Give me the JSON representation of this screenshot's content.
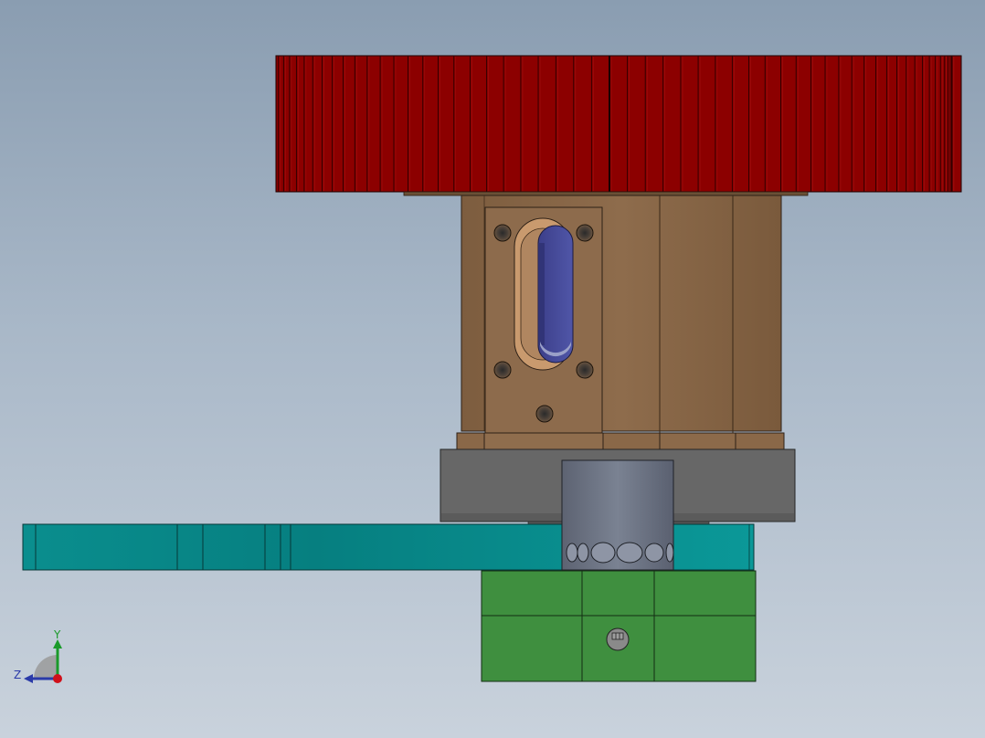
{
  "viewport": {
    "view_name": "Right",
    "background_top": "#8a9db1",
    "background_bottom": "#c9d2dc"
  },
  "parts": {
    "gear": {
      "name": "gear",
      "color": "#8c0000"
    },
    "motor_housing": {
      "name": "motor-housing",
      "color": "#8b6848"
    },
    "motor_window_slot": {
      "name": "motor-window-slot",
      "color": "#4a4fa0"
    },
    "grey_collar": {
      "name": "grey-collar",
      "color": "#676767"
    },
    "shaft": {
      "name": "shaft",
      "color": "#6e7585"
    },
    "teal_arm": {
      "name": "teal-arm",
      "color": "#0b9494"
    },
    "green_block": {
      "name": "green-block",
      "color": "#3f8f3f"
    }
  },
  "triad": {
    "y_label": "Y",
    "z_label": "Z",
    "y_color": "#1a9a2a",
    "z_color": "#2a3aa8",
    "x_color": "#d0101a"
  }
}
